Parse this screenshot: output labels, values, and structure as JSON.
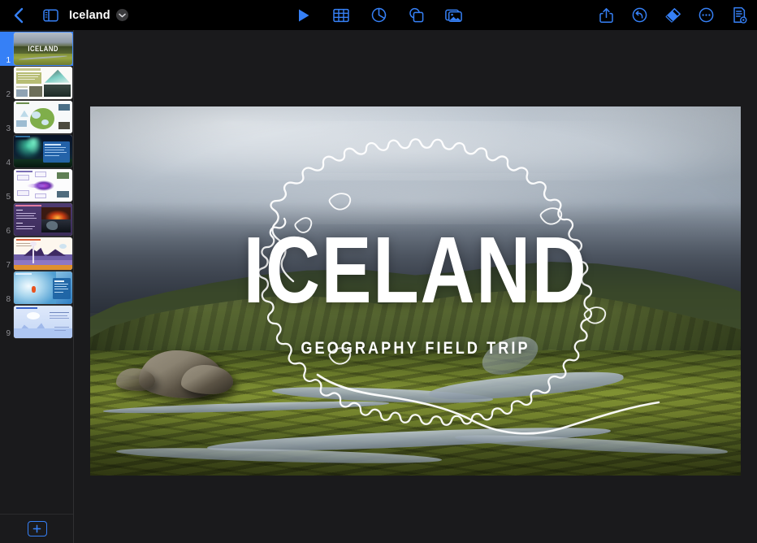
{
  "app": {
    "name": "Keynote",
    "background": "#1a1a1c",
    "toolbar_background": "#000000",
    "accent": "#3680f6"
  },
  "toolbar": {
    "back_label": "Back",
    "back_icon": "chevron-left-icon",
    "sidebar_toggle_icon": "sidebar-toggle-icon",
    "document_title": "Iceland",
    "title_chevron_icon": "chevron-down-icon",
    "center_items": [
      {
        "name": "play-button",
        "icon": "play-icon",
        "label": "Play"
      },
      {
        "name": "insert-table-button",
        "icon": "table-icon",
        "label": "Table"
      },
      {
        "name": "insert-chart-button",
        "icon": "chart-pie-icon",
        "label": "Chart"
      },
      {
        "name": "insert-shape-button",
        "icon": "shapes-icon",
        "label": "Shape"
      },
      {
        "name": "insert-media-button",
        "icon": "media-photo-icon",
        "label": "Media"
      }
    ],
    "right_items": [
      {
        "name": "share-button",
        "icon": "share-icon",
        "label": "Share"
      },
      {
        "name": "undo-button",
        "icon": "undo-icon",
        "label": "Undo"
      },
      {
        "name": "format-button",
        "icon": "paintbrush-icon",
        "label": "Format"
      },
      {
        "name": "more-button",
        "icon": "ellipsis-circle-icon",
        "label": "More"
      },
      {
        "name": "document-options-button",
        "icon": "document-icon",
        "label": "Document"
      }
    ]
  },
  "sidebar": {
    "add_slide_label": "+",
    "add_slide_icon": "plus-icon",
    "selected_slide": 1,
    "slides": [
      {
        "number": "1",
        "name": "slide-thumbnail-1",
        "title": "ICELAND",
        "kind": "title-photo"
      },
      {
        "number": "2",
        "name": "slide-thumbnail-2",
        "title": "",
        "kind": "text-photos-light"
      },
      {
        "number": "3",
        "name": "slide-thumbnail-3",
        "title": "",
        "kind": "map-light"
      },
      {
        "number": "4",
        "name": "slide-thumbnail-4",
        "title": "",
        "kind": "aurora-dark"
      },
      {
        "number": "5",
        "name": "slide-thumbnail-5",
        "title": "",
        "kind": "diagram-light"
      },
      {
        "number": "6",
        "name": "slide-thumbnail-6",
        "title": "",
        "kind": "volcano-purple"
      },
      {
        "number": "7",
        "name": "slide-thumbnail-7",
        "title": "",
        "kind": "geyser-cream"
      },
      {
        "number": "8",
        "name": "slide-thumbnail-8",
        "title": "",
        "kind": "glacier-blue"
      },
      {
        "number": "9",
        "name": "slide-thumbnail-9",
        "title": "",
        "kind": "iceberg-pale"
      }
    ]
  },
  "slide": {
    "name": "slide-canvas",
    "title": "ICELAND",
    "subtitle": "GEOGRAPHY FIELD TRIP",
    "background_description": "Iceland highland landscape photograph with mossy green mountains, braided river and stormy sky",
    "overlay_description": "White outline map of Iceland"
  }
}
